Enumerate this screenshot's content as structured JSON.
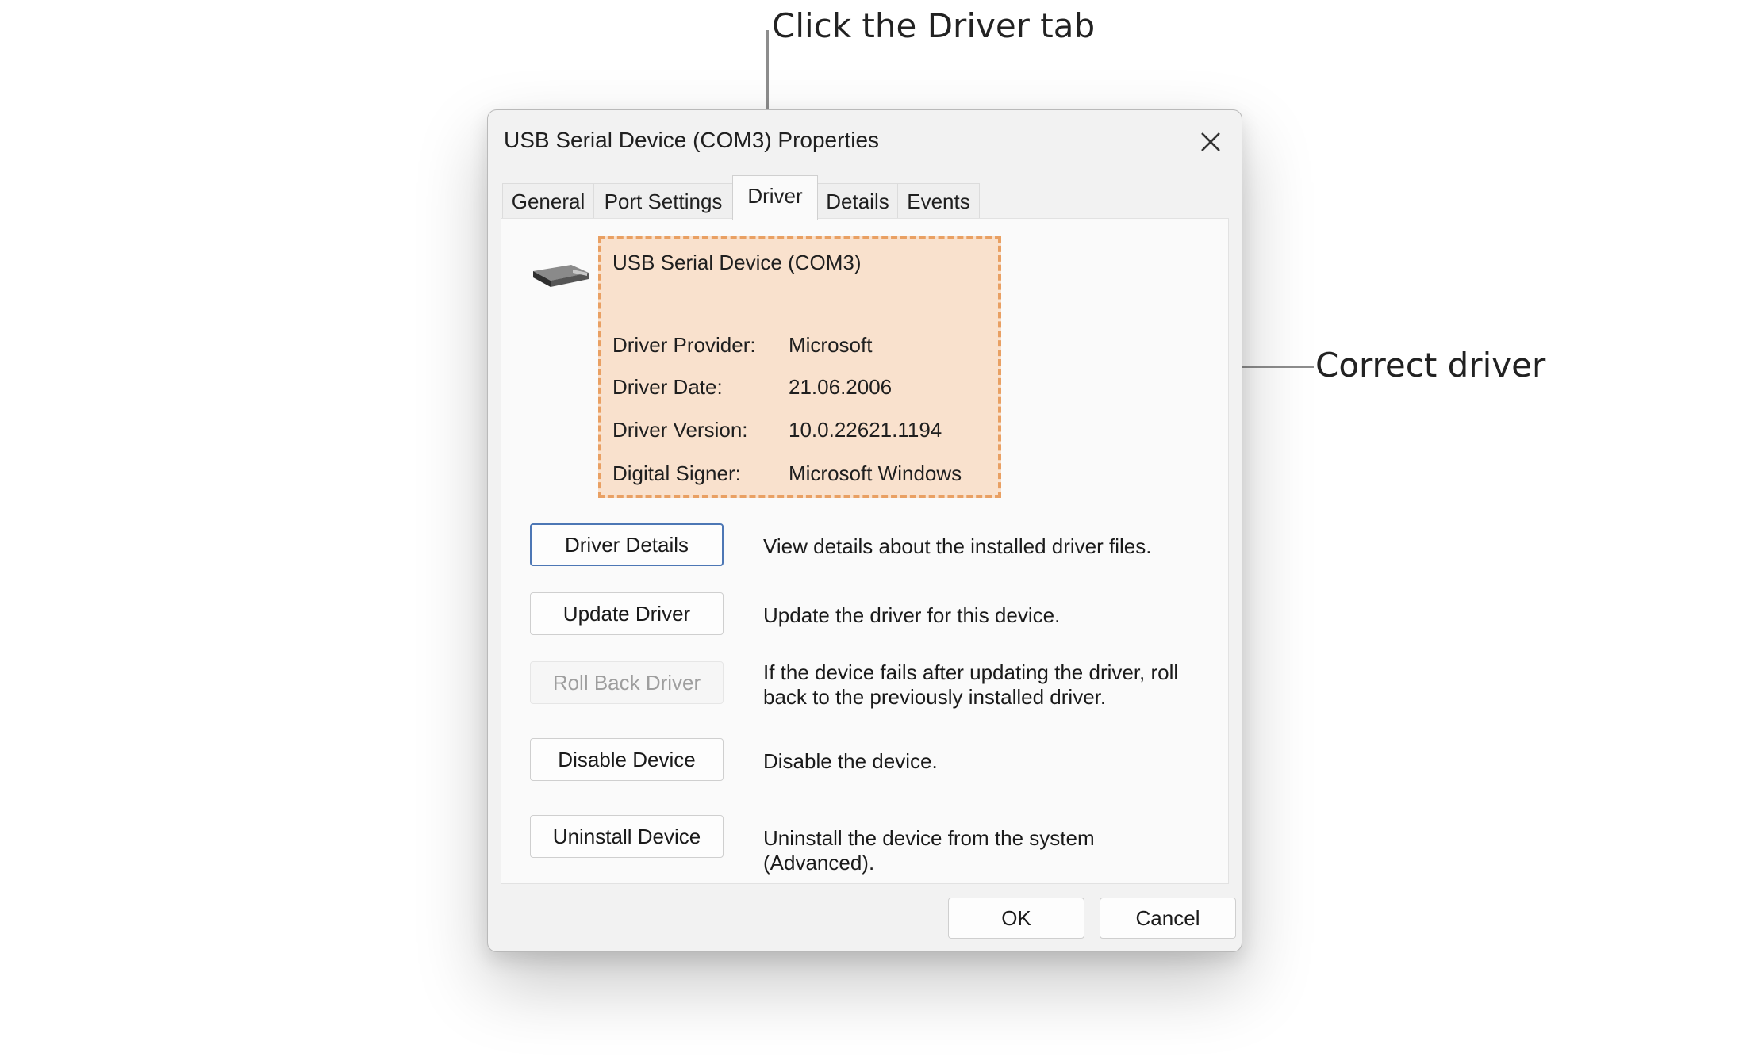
{
  "annotations": {
    "tab_callout": "Click the Driver tab",
    "driver_callout": "Correct driver"
  },
  "dialog": {
    "title": "USB Serial Device (COM3) Properties",
    "close_icon": "close-icon",
    "tabs": [
      {
        "label": "General",
        "active": false
      },
      {
        "label": "Port Settings",
        "active": false
      },
      {
        "label": "Driver",
        "active": true
      },
      {
        "label": "Details",
        "active": false
      },
      {
        "label": "Events",
        "active": false
      }
    ]
  },
  "driver_info": {
    "device_icon": "usb-serial-device-icon",
    "device_name": "USB Serial Device (COM3)",
    "rows": [
      {
        "label": "Driver Provider:",
        "value": "Microsoft"
      },
      {
        "label": "Driver Date:",
        "value": "21.06.2006"
      },
      {
        "label": "Driver Version:",
        "value": "10.0.22621.1194"
      },
      {
        "label": "Digital Signer:",
        "value": "Microsoft Windows"
      }
    ],
    "highlight_color": "#f9e1cd",
    "highlight_border": "#e9a063"
  },
  "actions": [
    {
      "label": "Driver Details",
      "description": "View details about the installed driver files.",
      "enabled": true,
      "focused": true
    },
    {
      "label": "Update Driver",
      "description": "Update the driver for this device.",
      "enabled": true,
      "focused": false
    },
    {
      "label": "Roll Back Driver",
      "description": "If the device fails after updating the driver, roll back to the previously installed driver.",
      "enabled": false,
      "focused": false
    },
    {
      "label": "Disable Device",
      "description": "Disable the device.",
      "enabled": true,
      "focused": false
    },
    {
      "label": "Uninstall Device",
      "description": "Uninstall the device from the system (Advanced).",
      "enabled": true,
      "focused": false
    }
  ],
  "footer": {
    "ok_label": "OK",
    "cancel_label": "Cancel"
  }
}
